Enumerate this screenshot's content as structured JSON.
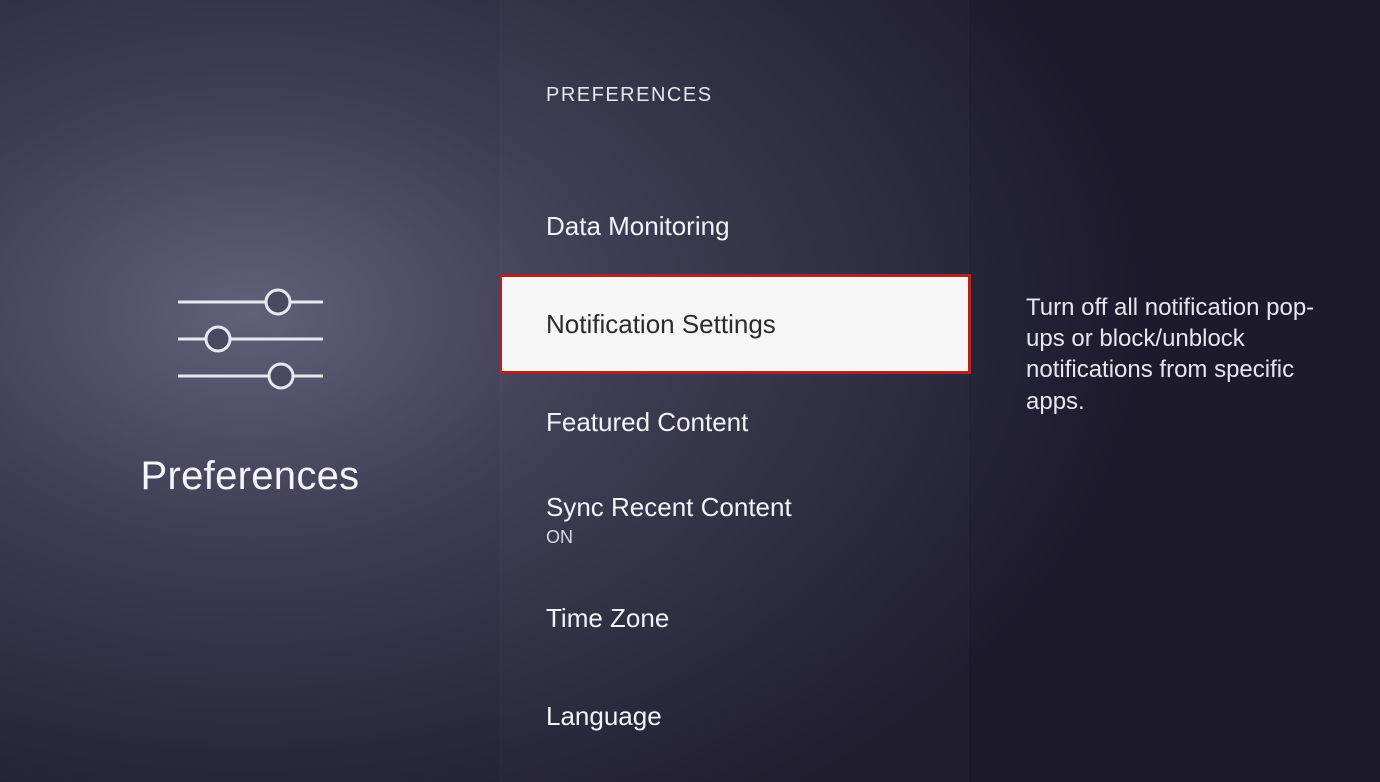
{
  "left": {
    "title": "Preferences"
  },
  "middle": {
    "heading": "PREFERENCES",
    "items": {
      "data_monitoring": {
        "label": "Data Monitoring"
      },
      "notification_settings": {
        "label": "Notification Settings"
      },
      "featured_content": {
        "label": "Featured Content"
      },
      "sync_recent_content": {
        "label": "Sync Recent Content",
        "sub": "ON"
      },
      "time_zone": {
        "label": "Time Zone"
      },
      "language": {
        "label": "Language"
      }
    }
  },
  "right": {
    "description": "Turn off all notification pop-ups or block/unblock notifications from specific apps."
  }
}
